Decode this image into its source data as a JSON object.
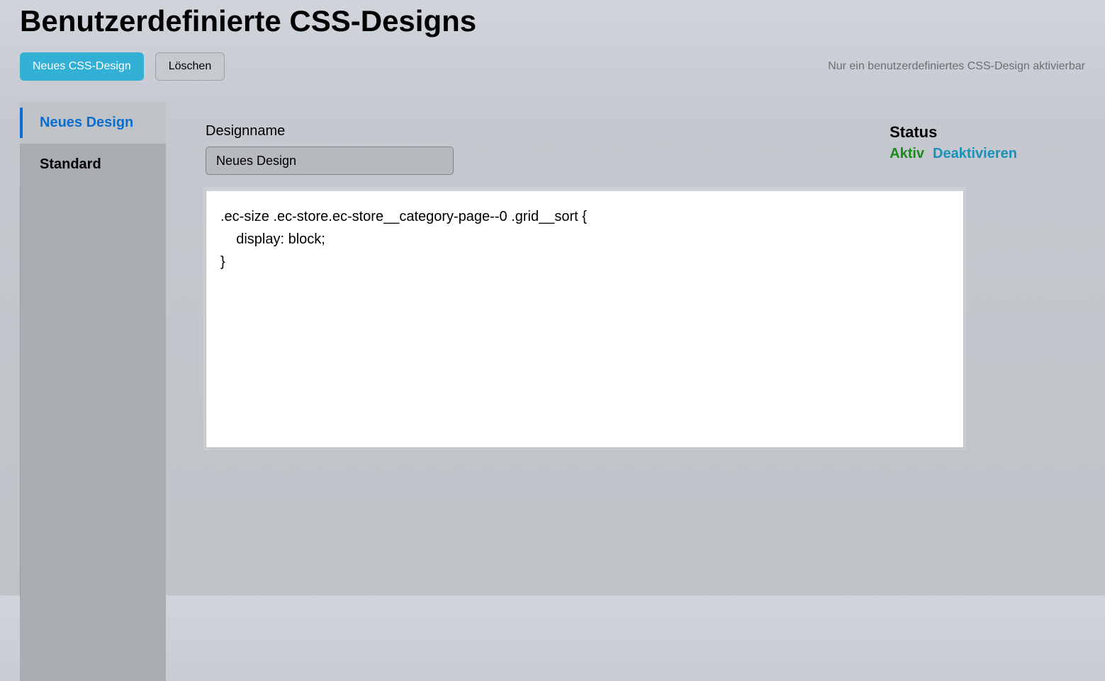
{
  "page": {
    "title": "Benutzerdefinierte CSS-Designs"
  },
  "toolbar": {
    "new_label": "Neues CSS-Design",
    "delete_label": "Löschen",
    "hint": "Nur ein benutzerdefiniertes CSS-Design aktivierbar"
  },
  "sidebar": {
    "items": [
      {
        "label": "Neues Design"
      },
      {
        "label": "Standard"
      }
    ]
  },
  "form": {
    "designname_label": "Designname",
    "designname_value": "Neues Design",
    "status_label": "Status",
    "status_active": "Aktiv",
    "status_deactivate": "Deaktivieren",
    "css_code": ".ec-size .ec-store.ec-store__category-page--0 .grid__sort {\n    display: block;\n}"
  }
}
